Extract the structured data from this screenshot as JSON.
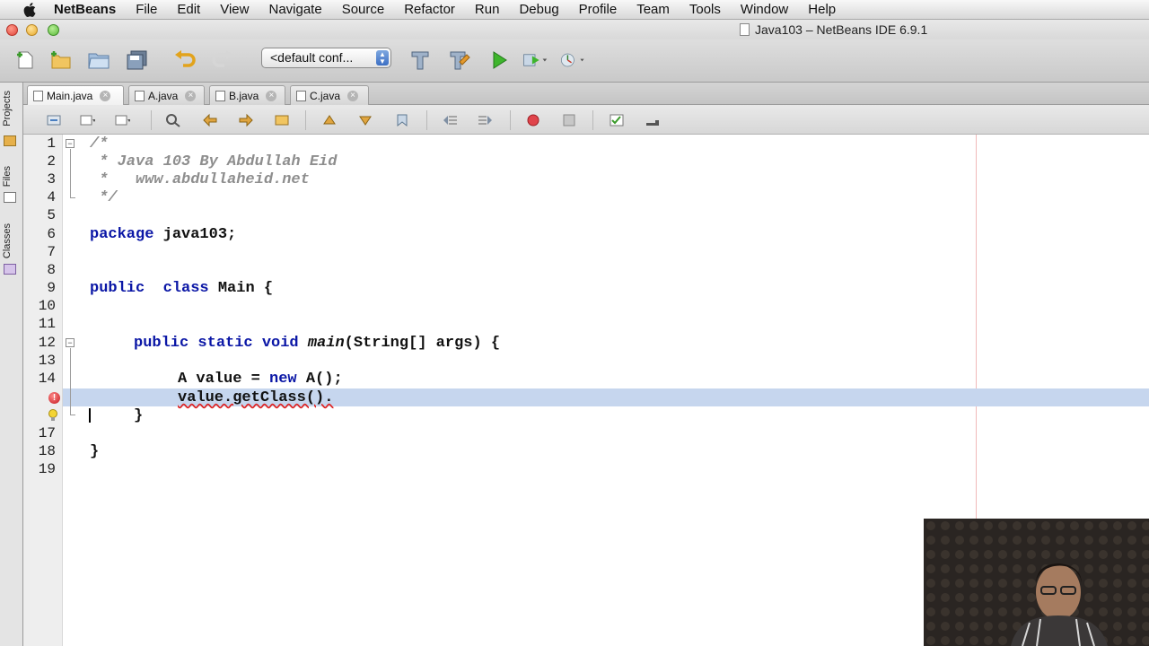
{
  "menubar": {
    "app_name": "NetBeans",
    "items": [
      "File",
      "Edit",
      "View",
      "Navigate",
      "Source",
      "Refactor",
      "Run",
      "Debug",
      "Profile",
      "Team",
      "Tools",
      "Window",
      "Help"
    ]
  },
  "window": {
    "title": "Java103 – NetBeans IDE 6.9.1"
  },
  "toolbar": {
    "config_value": "<default conf...",
    "icons": [
      "new-file-icon",
      "new-project-icon",
      "open-project-icon",
      "save-all-icon",
      "undo-icon",
      "redo-icon",
      "build-icon",
      "clean-build-icon",
      "run-icon",
      "debug-icon",
      "profile-icon"
    ]
  },
  "side_tabs": [
    "Projects",
    "Files",
    "Classes"
  ],
  "file_tabs": [
    {
      "label": "Main.java",
      "active": true
    },
    {
      "label": "A.java",
      "active": false
    },
    {
      "label": "B.java",
      "active": false
    },
    {
      "label": "C.java",
      "active": false
    }
  ],
  "editor": {
    "line_numbers": [
      "1",
      "2",
      "3",
      "4",
      "5",
      "6",
      "7",
      "8",
      "9",
      "10",
      "11",
      "12",
      "13",
      "14",
      "",
      "",
      "17",
      "18",
      "19"
    ],
    "code": {
      "l1": "/*",
      "l2": " * Java 103 By Abdullah Eid",
      "l3": " *   www.abdullaheid.net",
      "l4": " */",
      "l6_kw": "package",
      "l6_rest": " java103;",
      "l9_kw1": "public",
      "l9_kw2": "class",
      "l9_rest": " Main {",
      "l12_kw": "public static void",
      "l12_method": "main",
      "l12_rest": "(String[] args) {",
      "l14_a": "A value = ",
      "l14_kw": "new",
      "l14_b": " A();",
      "l15": "value.getClass().",
      "l16": "}",
      "l18": "}"
    },
    "highlight_color": "#c6d6ee",
    "keyword_color": "#0b17a6",
    "comment_color": "#8e8e8e"
  }
}
